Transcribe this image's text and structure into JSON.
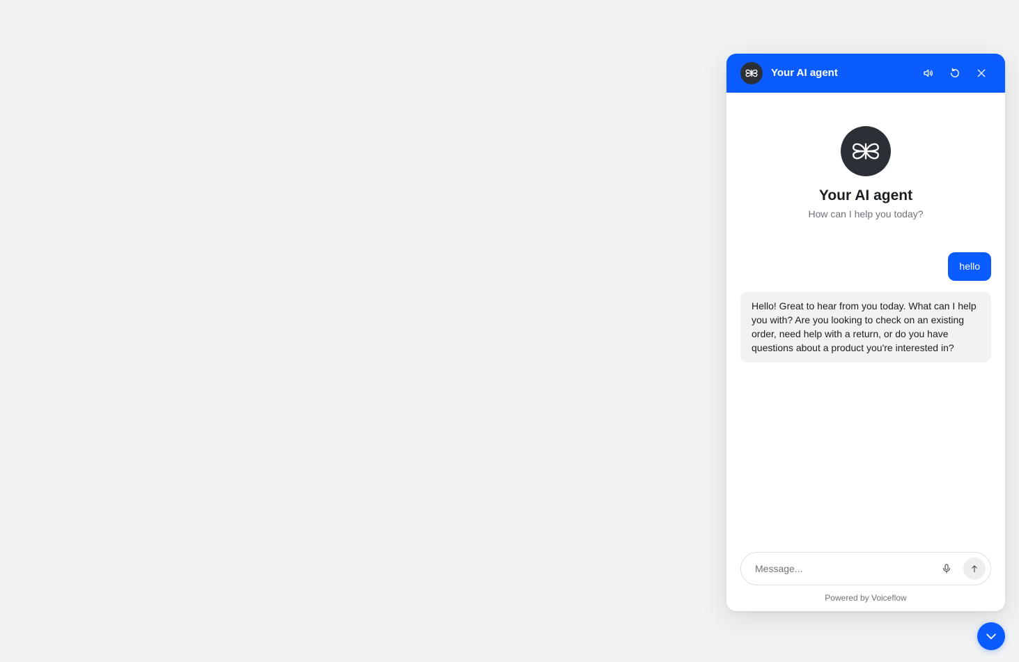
{
  "header": {
    "title": "Your AI agent",
    "avatar_icon": "voiceflow-logo-icon",
    "background": "#0b5cff",
    "actions": [
      {
        "name": "sound",
        "icon": "speaker-icon"
      },
      {
        "name": "restart",
        "icon": "restart-icon"
      },
      {
        "name": "close",
        "icon": "close-icon"
      }
    ]
  },
  "welcome": {
    "title": "Your AI agent",
    "subtitle": "How can I help you today?",
    "avatar_icon": "voiceflow-logo-icon"
  },
  "messages": [
    {
      "role": "user",
      "text": "hello"
    },
    {
      "role": "assistant",
      "text": "Hello! Great to hear from you today. What can I help you with? Are you looking to check on an existing order, need help with a return, or do you have questions about a product you're interested in?"
    }
  ],
  "composer": {
    "placeholder": "Message...",
    "value": "",
    "mic_icon": "microphone-icon",
    "send_icon": "arrow-up-icon"
  },
  "footer": {
    "powered_by": "Powered by Voiceflow"
  },
  "launcher": {
    "icon": "chevron-down-icon"
  },
  "colors": {
    "accent": "#0b5cff",
    "page_background": "#f1f2f2",
    "avatar_background": "#2b2f36",
    "bot_bubble": "#f1f2f2"
  }
}
